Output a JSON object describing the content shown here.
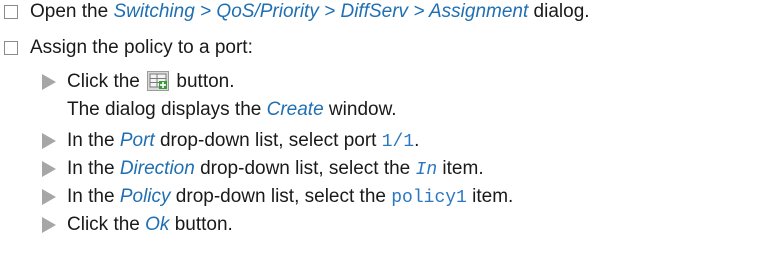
{
  "step1": {
    "pre": "Open the ",
    "menu_path": "Switching > QoS/Priority > DiffServ > Assignment",
    "post": " dialog."
  },
  "step2": {
    "text": "Assign the policy to a port:"
  },
  "substeps": {
    "a": {
      "pre": "Click the ",
      "post": " button.",
      "icon": "create-table-icon"
    },
    "a_note": {
      "pre": "The dialog displays the ",
      "ui": "Create",
      "post": " window."
    },
    "b": {
      "pre": "In the ",
      "ui": "Port",
      "mid": " drop-down list, select port ",
      "code": "1/1",
      "post": "."
    },
    "c": {
      "pre": "In the ",
      "ui": "Direction",
      "mid": " drop-down list, select the ",
      "code": "In",
      "post": " item."
    },
    "d": {
      "pre": "In the ",
      "ui": "Policy",
      "mid": " drop-down list, select the ",
      "code": "policy1",
      "post": " item."
    },
    "e": {
      "pre": "Click the ",
      "ui": "Ok",
      "post": " button."
    }
  }
}
